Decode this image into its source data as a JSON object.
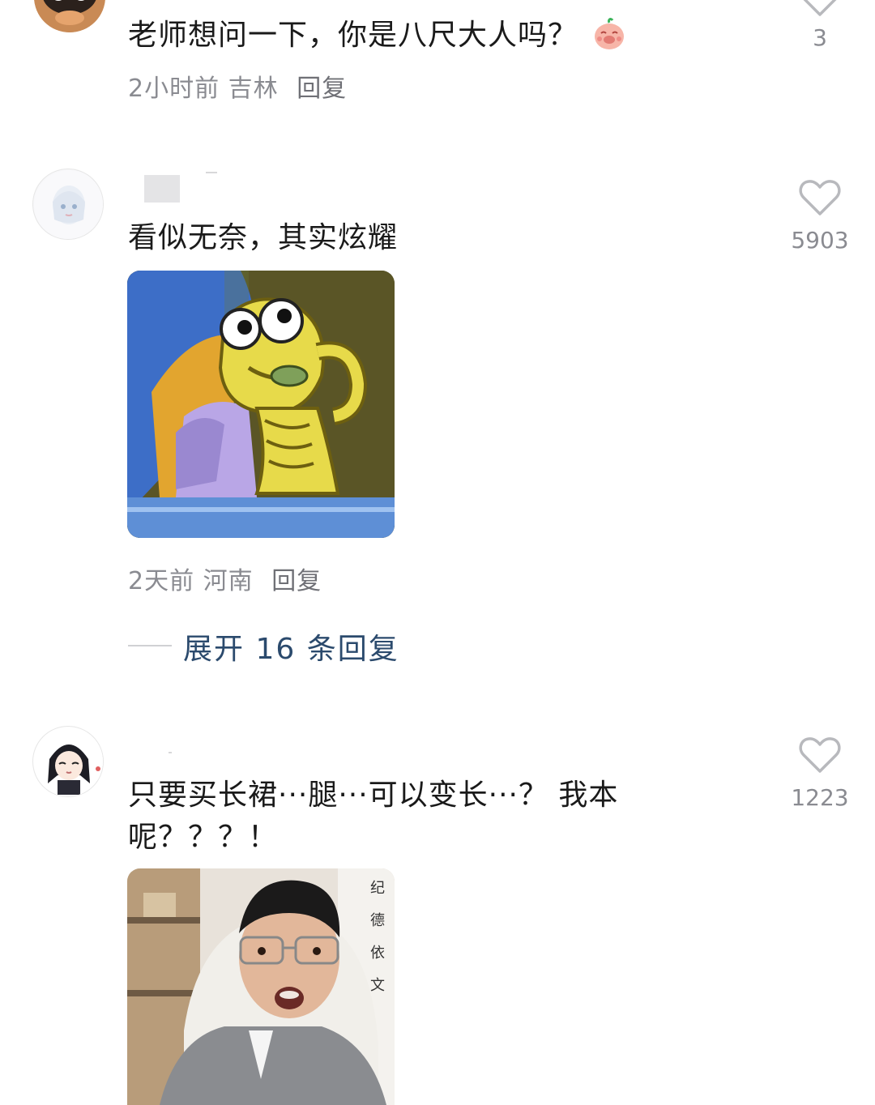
{
  "comments": [
    {
      "text": "老师想问一下，你是八尺大人吗？",
      "emoji": "pig-face-emoji",
      "time": "2小时前",
      "location": "吉林",
      "reply_label": "回复",
      "likes": "3"
    },
    {
      "text": "看似无奈，其实炫耀",
      "image": "fish-cartoon-meme",
      "time": "2天前",
      "location": "河南",
      "reply_label": "回复",
      "likes": "5903",
      "expand_label": "展开 16 条回复"
    },
    {
      "text_line1": "只要买长裙···腿···可以变长···？ 我本",
      "text_line2": "呢？？？！",
      "image": "man-with-glasses-surprised-photo",
      "likes": "1223"
    }
  ],
  "colors": {
    "text": "#1a1a1a",
    "meta": "#8a8b91",
    "link": "#2b4a6d",
    "heart": "#b8b9bd"
  }
}
